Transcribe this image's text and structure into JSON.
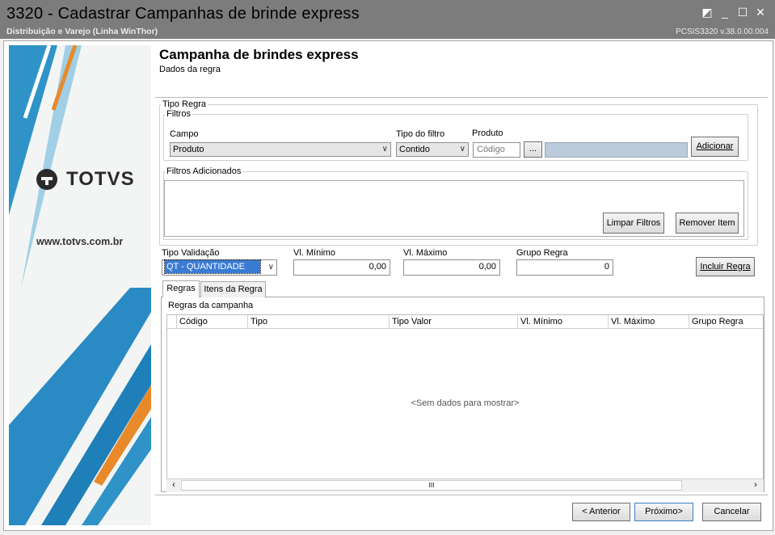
{
  "window": {
    "title": "3320 - Cadastrar Campanhas de brinde express",
    "subtitle": "Distribuição e Varejo (Linha WinThor)",
    "version": "PCSIS3320  v.38.0.00.004",
    "controls": {
      "restore": "◩",
      "minimize": "_",
      "maximize": "☐",
      "close": "✕"
    }
  },
  "banner": {
    "logo_text": "TOTVS",
    "url": "www.totvs.com.br",
    "colors": {
      "blue": "#1f7fb8",
      "orange": "#e88a2a"
    }
  },
  "wizard": {
    "title": "Campanha de brindes express",
    "subtitle": "Dados da regra"
  },
  "tipo_regra": {
    "legend": "Tipo Regra",
    "filtros": {
      "legend": "Filtros",
      "campo_label": "Campo",
      "campo_value": "Produto",
      "tipo_filtro_label": "Tipo do filtro",
      "tipo_filtro_value": "Contido",
      "produto_label": "Produto",
      "produto_placeholder": "Código",
      "browse_label": "...",
      "adicionar_label": "Adicionar"
    },
    "adicionados": {
      "legend": "Filtros Adicionados",
      "limpar_label": "Limpar Filtros",
      "remover_label": "Remover Item"
    }
  },
  "validacao": {
    "tipo_label": "Tipo Validação",
    "tipo_value": "QT - QUANTIDADE",
    "vl_min_label": "Vl. Mínimo",
    "vl_min_value": "0,00",
    "vl_max_label": "Vl. Máximo",
    "vl_max_value": "0,00",
    "grupo_label": "Grupo Regra",
    "grupo_value": "0",
    "incluir_label": "Incluir Regra"
  },
  "tabs": [
    {
      "label": "Regras"
    },
    {
      "label": "Itens da Regra"
    }
  ],
  "grid": {
    "caption": "Regras da campanha",
    "columns": [
      "Código",
      "Tipo",
      "Tipo Valor",
      "Vl. Mínimo",
      "Vl. Máximo",
      "Grupo Regra"
    ],
    "empty_text": "<Sem dados para mostrar>",
    "scroll_grip": "III"
  },
  "footer": {
    "anterior_label": "< Anterior",
    "proximo_label": "Próximo>",
    "cancelar_label": "Cancelar"
  }
}
